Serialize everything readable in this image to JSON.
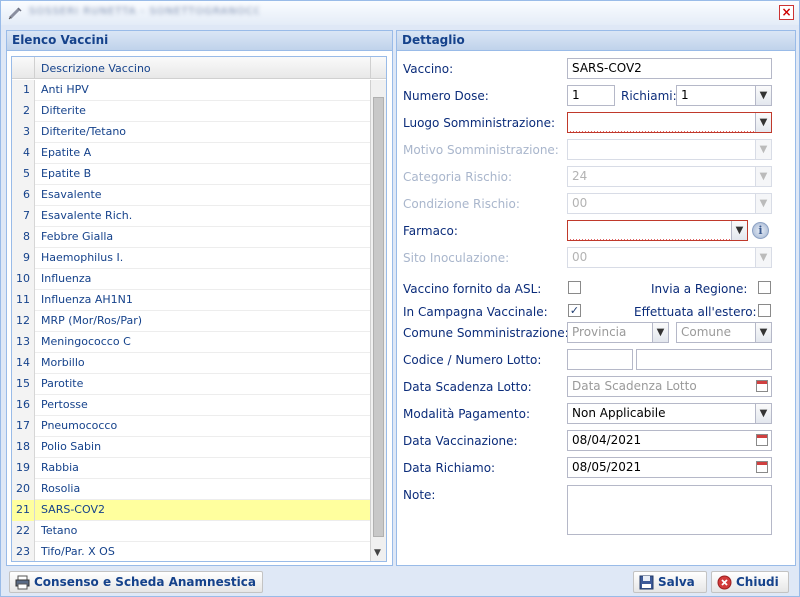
{
  "window": {
    "title": "SOSSERI RUNETTA - SONETTOGRANOCOFF"
  },
  "left_panel": {
    "title": "Elenco Vaccini",
    "column_header": "Descrizione Vaccino",
    "rows": [
      {
        "n": "1",
        "label": "Anti HPV"
      },
      {
        "n": "2",
        "label": "Difterite"
      },
      {
        "n": "3",
        "label": "Difterite/Tetano"
      },
      {
        "n": "4",
        "label": "Epatite A"
      },
      {
        "n": "5",
        "label": "Epatite B"
      },
      {
        "n": "6",
        "label": "Esavalente"
      },
      {
        "n": "7",
        "label": "Esavalente Rich."
      },
      {
        "n": "8",
        "label": "Febbre Gialla"
      },
      {
        "n": "9",
        "label": "Haemophilus I."
      },
      {
        "n": "10",
        "label": "Influenza"
      },
      {
        "n": "11",
        "label": "Influenza AH1N1"
      },
      {
        "n": "12",
        "label": "MRP (Mor/Ros/Par)"
      },
      {
        "n": "13",
        "label": "Meningococco C"
      },
      {
        "n": "14",
        "label": "Morbillo"
      },
      {
        "n": "15",
        "label": "Parotite"
      },
      {
        "n": "16",
        "label": "Pertosse"
      },
      {
        "n": "17",
        "label": "Pneumococco"
      },
      {
        "n": "18",
        "label": "Polio Sabin"
      },
      {
        "n": "19",
        "label": "Rabbia"
      },
      {
        "n": "20",
        "label": "Rosolia"
      },
      {
        "n": "21",
        "label": "SARS-COV2"
      },
      {
        "n": "22",
        "label": "Tetano"
      },
      {
        "n": "23",
        "label": "Tifo/Par. X OS"
      }
    ],
    "selected_row": "21"
  },
  "right_panel": {
    "title": "Dettaglio",
    "vaccino": {
      "label": "Vaccino:",
      "value": "SARS-COV2"
    },
    "numero_dose": {
      "label": "Numero Dose:",
      "value": "1"
    },
    "richiami": {
      "label": "Richiami:",
      "value": "1"
    },
    "luogo": {
      "label": "Luogo Somministrazione:",
      "value": ""
    },
    "motivo": {
      "label": "Motivo Somministrazione:",
      "value": ""
    },
    "categoria": {
      "label": "Categoria Rischio:",
      "value": "24"
    },
    "condizione": {
      "label": "Condizione Rischio:",
      "value": "00"
    },
    "farmaco": {
      "label": "Farmaco:",
      "value": ""
    },
    "sito": {
      "label": "Sito Inoculazione:",
      "value": "00"
    },
    "fornito_asl": {
      "label": "Vaccino fornito da ASL:",
      "checked": false
    },
    "invia_regione": {
      "label": "Invia a Regione:",
      "checked": false
    },
    "in_campagna": {
      "label": "In Campagna Vaccinale:",
      "checked": true
    },
    "effettuata_estero": {
      "label": "Effettuata all'estero:",
      "checked": false
    },
    "comune": {
      "label": "Comune Somministrazione:",
      "provincia_placeholder": "Provincia",
      "comune_placeholder": "Comune"
    },
    "lotto": {
      "label": "Codice / Numero Lotto:",
      "codice": "",
      "numero": ""
    },
    "scadenza": {
      "label": "Data Scadenza Lotto:",
      "placeholder": "Data Scadenza Lotto"
    },
    "pagamento": {
      "label": "Modalità Pagamento:",
      "value": "Non Applicabile"
    },
    "data_vaccinazione": {
      "label": "Data Vaccinazione:",
      "value": "08/04/2021"
    },
    "data_richiamo": {
      "label": "Data Richiamo:",
      "value": "08/05/2021"
    },
    "note": {
      "label": "Note:",
      "value": ""
    }
  },
  "bottom": {
    "consenso_label": "Consenso e Scheda Anamnestica",
    "salva_label": "Salva",
    "chiudi_label": "Chiudi"
  }
}
